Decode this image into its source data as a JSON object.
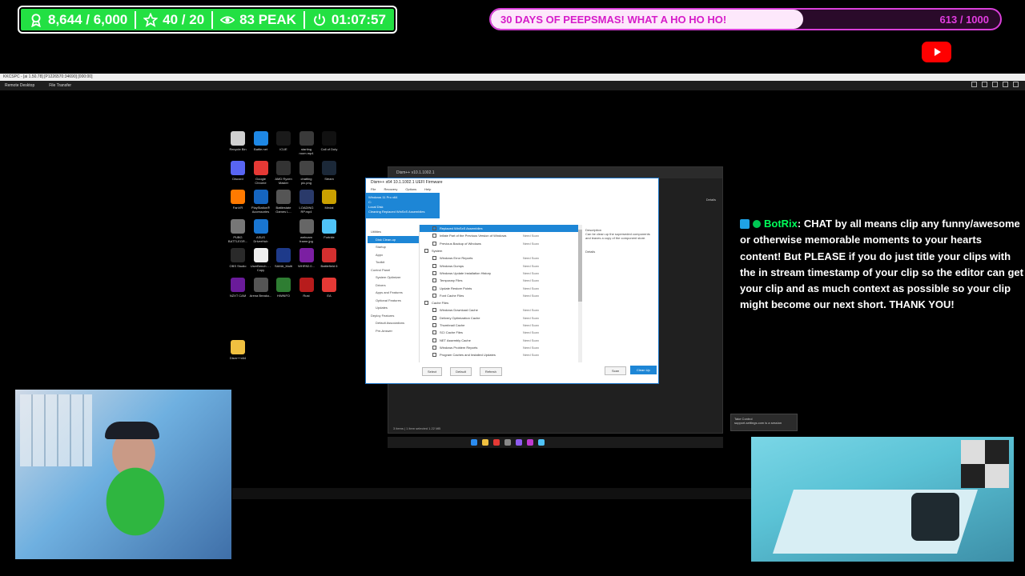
{
  "stats": {
    "followers": "8,644 / 6,000",
    "subs": "40 / 20",
    "peak": "83 PEAK",
    "uptime": "01:07:57"
  },
  "goal": {
    "label": "30 DAYS OF PEEPSMAS! WHAT A HO HO HO!",
    "count": "613 / 1000",
    "progress": 0.613
  },
  "remote": {
    "title": "KKCSPC - [ai 1.50.78] [P1226570:34690] [000:00]",
    "tool_remote": "Remote Desktop",
    "tool_files": "File Transfer"
  },
  "desktop_icons": [
    {
      "label": "Recycle Bin",
      "color": "#d0d0d0"
    },
    {
      "label": "Battle.net",
      "color": "#1e88e5"
    },
    {
      "label": "iCUE",
      "color": "#1a1a1a"
    },
    {
      "label": "starting room.mp4",
      "color": "#3a3a3a"
    },
    {
      "label": "Call of Duty",
      "color": "#111111"
    },
    {
      "label": "Discord",
      "color": "#5865f2"
    },
    {
      "label": "Google Chrome",
      "color": "#e53935"
    },
    {
      "label": "AMD Ryzen Master",
      "color": "#333333"
    },
    {
      "label": "chatting pic.png",
      "color": "#444444"
    },
    {
      "label": "Steam",
      "color": "#1b2838"
    },
    {
      "label": "FanVR",
      "color": "#ff7a00"
    },
    {
      "label": "PlayStation® Accessories",
      "color": "#1565c0"
    },
    {
      "label": "Battlestate Games L...",
      "color": "#555555"
    },
    {
      "label": "LOADING RP.mp4",
      "color": "#2a3a6a"
    },
    {
      "label": "Medal",
      "color": "#caa000"
    },
    {
      "label": "PUBG BATTLEGR...",
      "color": "#777777"
    },
    {
      "label": "ASUS DriverHub",
      "color": "#1976d2"
    },
    {
      "label": "",
      "color": "#000000"
    },
    {
      "label": "webcam frame.jpg",
      "color": "#666666"
    },
    {
      "label": "Fortnite",
      "color": "#4fc3f7"
    },
    {
      "label": "OBS Studio",
      "color": "#2a2a2a"
    },
    {
      "label": "UserBench... - Copy",
      "color": "#eeeeee"
    },
    {
      "label": "SAMA_Multi",
      "color": "#1e3a8a"
    },
    {
      "label": "WHR92.0...",
      "color": "#7b1fa2"
    },
    {
      "label": "Battlefield 6",
      "color": "#d32f2f"
    },
    {
      "label": "NZXT CAM",
      "color": "#6a1b9a"
    },
    {
      "label": "Arena Breako...",
      "color": "#555555"
    },
    {
      "label": "HWiNFO",
      "color": "#2e7d32"
    },
    {
      "label": "Rust",
      "color": "#b71c1c"
    },
    {
      "label": "EA",
      "color": "#e53935"
    },
    {
      "label": "Dism++x64",
      "color": "#f0c040"
    }
  ],
  "explorer": {
    "tab": "Dism++ v10.1.1002.1",
    "address": "Dism++v10.1.1002.1",
    "details": "Details",
    "status": "3 items  |  1 item selected  1.22 MB"
  },
  "dism": {
    "title": "Dism++ x64 10.1.1002.1 UEFI Firmware",
    "menu": [
      "File",
      "Recovery",
      "Options",
      "Help"
    ],
    "banner": [
      "Windows 11 Pro x64",
      "C:",
      "Local Disk",
      "Cleaning Replaced WinSxS Assemblies"
    ],
    "nav": [
      {
        "label": "Utilities",
        "type": "head"
      },
      {
        "label": "Disk Clean-up",
        "type": "sel"
      },
      {
        "label": "Startup",
        "type": "sub"
      },
      {
        "label": "Appx",
        "type": "sub"
      },
      {
        "label": "Toolkit",
        "type": "sub"
      },
      {
        "label": "Control Panel",
        "type": "head"
      },
      {
        "label": "System Optimizer",
        "type": "sub"
      },
      {
        "label": "Drivers",
        "type": "sub"
      },
      {
        "label": "Apps and Features",
        "type": "sub"
      },
      {
        "label": "Optional Features",
        "type": "sub"
      },
      {
        "label": "Updates",
        "type": "sub"
      },
      {
        "label": "Deploy Features",
        "type": "head"
      },
      {
        "label": "Default Associations",
        "type": "sub"
      },
      {
        "label": "Pre-Answer",
        "type": "sub"
      }
    ],
    "rows": [
      {
        "name": "Replaced WinSxS Assemblies",
        "size": "",
        "type": "hl"
      },
      {
        "name": "Inflate Part of the Previous Version of Windows",
        "size": "Need Scan",
        "type": "item"
      },
      {
        "name": "Previous Backup of Windows",
        "size": "Need Scan",
        "type": "item"
      },
      {
        "name": "System",
        "size": "",
        "type": "cat"
      },
      {
        "name": "Windows Error Reports",
        "size": "Need Scan",
        "type": "item"
      },
      {
        "name": "Windows Dumps",
        "size": "Need Scan",
        "type": "item"
      },
      {
        "name": "Windows Update Installation History",
        "size": "Need Scan",
        "type": "item"
      },
      {
        "name": "Temporary Files",
        "size": "Need Scan",
        "type": "item"
      },
      {
        "name": "Update Restore Points",
        "size": "Need Scan",
        "type": "item"
      },
      {
        "name": "Font Cache Files",
        "size": "Need Scan",
        "type": "item"
      },
      {
        "name": "Cache Files",
        "size": "",
        "type": "cat"
      },
      {
        "name": "Windows Download Cache",
        "size": "Need Scan",
        "type": "item"
      },
      {
        "name": "Delivery Optimization Cache",
        "size": "Need Scan",
        "type": "item"
      },
      {
        "name": "Thumbnail Cache",
        "size": "Need Scan",
        "type": "item"
      },
      {
        "name": "SCI Cache Files",
        "size": "Need Scan",
        "type": "item"
      },
      {
        "name": "NET Assembly Cache",
        "size": "Need Scan",
        "type": "item"
      },
      {
        "name": "Windows Problem Reports",
        "size": "Need Scan",
        "type": "item"
      },
      {
        "name": "Program Caches and Installed Updates",
        "size": "Need Scan",
        "type": "item"
      }
    ],
    "desc_title": "Description",
    "desc_body": "Can be clean up the superseded components and leaves a copy of the component store.",
    "desc_size": "Details",
    "btn_select": "Select",
    "btn_default": "Default",
    "btn_refresh": "Refresh",
    "btn_scan": "Scan",
    "btn_clean": "Clean Up"
  },
  "chat": {
    "username": "BotRix",
    "message": ": CHAT by all means clip any funny/awesome or otherwise memorable moments to your hearts content! But PLEASE if you do just title your clips with the in stream timestamp of your clip so the editor can get your clip and as much context as possible so your clip might become our next short. THANK YOU!"
  },
  "notify": {
    "title": "Take Control",
    "body": "support-settings.com is a session"
  },
  "colors": {
    "stats_green": "#23e043",
    "goal_magenta": "#d61cc9",
    "dism_blue": "#1d86d6",
    "chat_user": "#00ff5a"
  }
}
